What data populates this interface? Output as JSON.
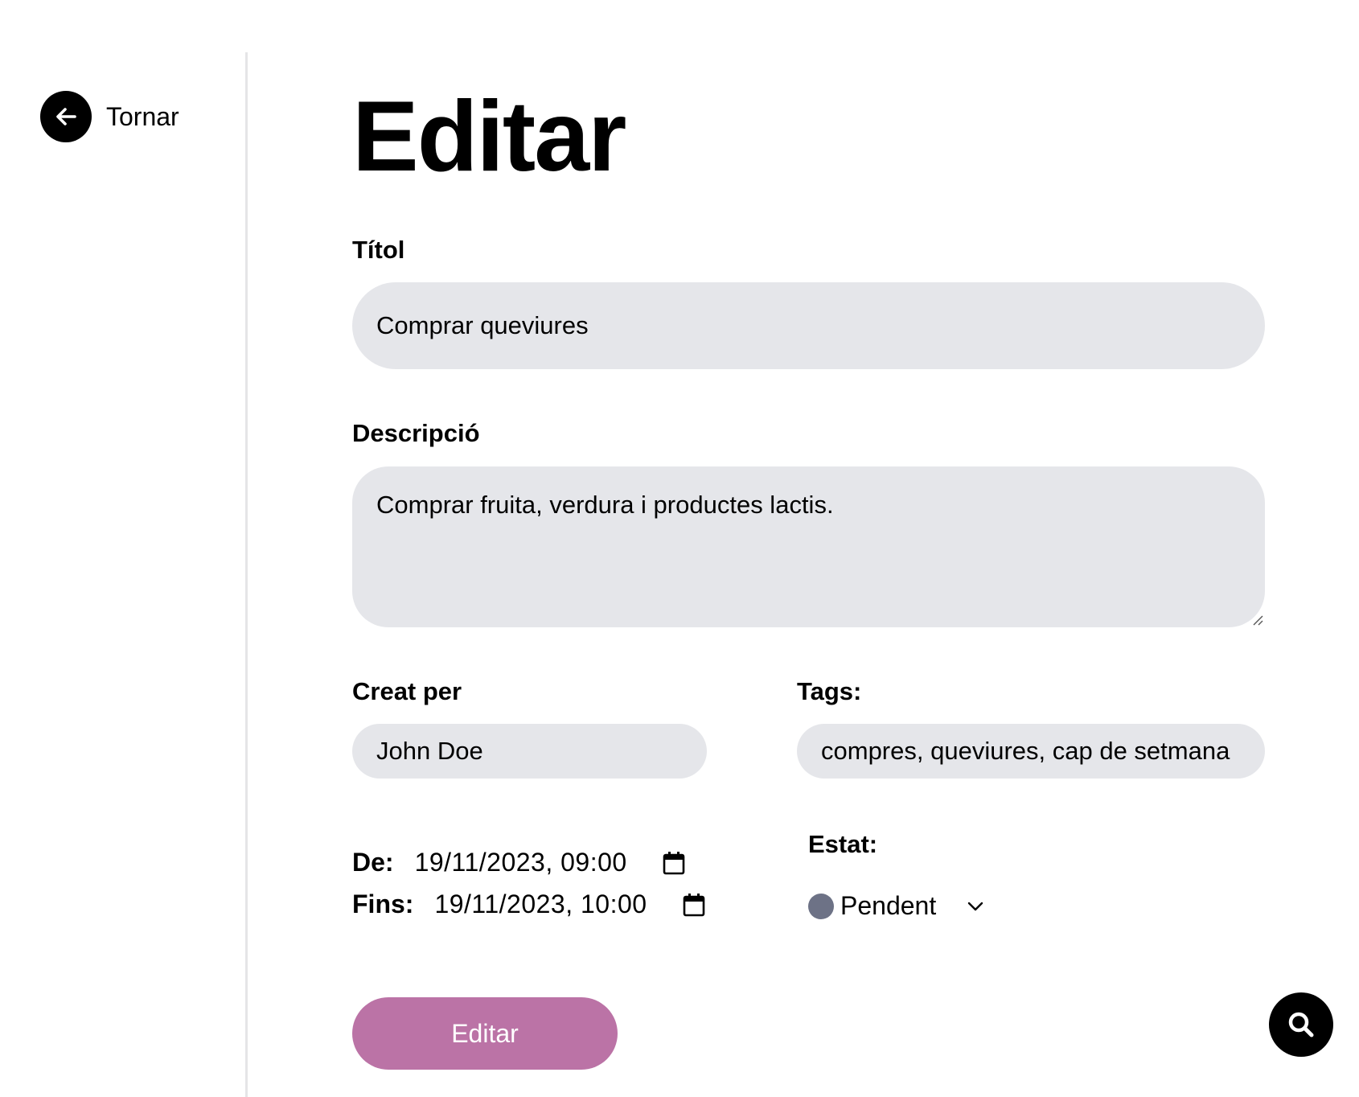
{
  "sidebar": {
    "back_label": "Tornar"
  },
  "main": {
    "title": "Editar",
    "fields": {
      "title_label": "Títol",
      "title_value": "Comprar queviures",
      "description_label": "Descripció",
      "description_value": "Comprar fruita, verdura i productes lactis.",
      "created_by_label": "Creat per",
      "created_by_value": "John Doe",
      "tags_label": "Tags:",
      "tags_value": "compres, queviures, cap de setmana",
      "from_label": "De:",
      "from_value": "19/11/2023, 09:00",
      "to_label": "Fins:",
      "to_value": "19/11/2023, 10:00",
      "status_label": "Estat:",
      "status_value": "Pendent"
    },
    "submit_label": "Editar"
  },
  "colors": {
    "input_bg": "#e5e6ea",
    "accent_button": "#bb73a6",
    "status_dot": "#6d7286",
    "divider": "#e5e5e7"
  },
  "icons": {
    "back": "arrow-left-icon",
    "calendar": "calendar-icon",
    "dropdown": "chevron-down-icon",
    "search": "search-icon",
    "resize": "resize-handle-icon"
  }
}
